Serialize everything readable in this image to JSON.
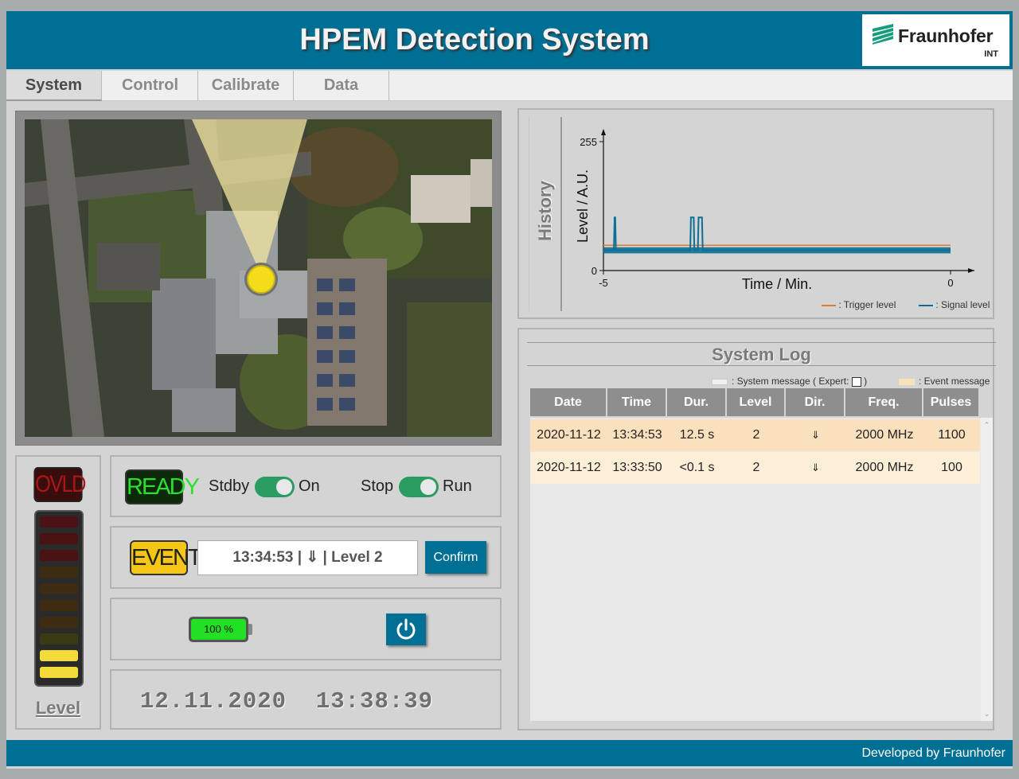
{
  "header": {
    "title": "HPEM Detection System",
    "logo_name": "Fraunhofer",
    "logo_sub": "INT"
  },
  "tabs": [
    {
      "label": "System",
      "active": true
    },
    {
      "label": "Control",
      "active": false
    },
    {
      "label": "Calibrate",
      "active": false
    },
    {
      "label": "Data",
      "active": false
    }
  ],
  "level_meter": {
    "ovld_label": "OVLD",
    "label": "Level",
    "segments_total": 10,
    "segments_lit": 2
  },
  "status": {
    "ready_label": "READY",
    "standby_label": "Stdby",
    "on_label": "On",
    "stop_label": "Stop",
    "run_label": "Run",
    "power_toggle_on": true,
    "run_toggle_on": true
  },
  "event": {
    "indicator_label": "EVENT",
    "message": "13:34:53 | ⇓ | Level 2",
    "confirm_label": "Confirm"
  },
  "battery": {
    "label": "100 %",
    "percent": 100
  },
  "clock": {
    "date": "12.11.2020",
    "time": "13:38:39"
  },
  "history": {
    "panel_label": "History",
    "chart_data": {
      "type": "line",
      "xlabel": "Time / Min.",
      "ylabel": "Level / A.U.",
      "xlim": [
        -5,
        0
      ],
      "ylim": [
        0,
        255
      ],
      "yticks": [
        0,
        255
      ],
      "xticks": [
        -5,
        0
      ],
      "series": [
        {
          "name": "Trigger level",
          "color": "#e07b2a",
          "x": [
            -5,
            0
          ],
          "y": [
            50,
            50
          ]
        },
        {
          "name": "Signal level",
          "color": "#0e6f96",
          "x": [
            -5,
            -4.85,
            -4.84,
            -4.83,
            -4.82,
            -3.75,
            -3.74,
            -3.7,
            -3.69,
            -3.64,
            -3.63,
            -3.58,
            -3.57,
            -3.56,
            -3.55,
            0
          ],
          "y": [
            40,
            40,
            105,
            105,
            40,
            40,
            105,
            105,
            40,
            40,
            105,
            105,
            40,
            40,
            40,
            40
          ]
        }
      ]
    },
    "legend": {
      "trigger": "Trigger level",
      "signal": "Signal level"
    }
  },
  "log": {
    "title": "System Log",
    "legend_system": "System message ( Expert:",
    "legend_system_close": ")",
    "legend_event": "Event message",
    "columns": [
      "Date",
      "Time",
      "Dur.",
      "Level",
      "Dir.",
      "Freq.",
      "Pulses"
    ],
    "rows": [
      [
        "2020-11-12",
        "13:34:53",
        "12.5 s",
        "2",
        "⇓",
        "2000 MHz",
        "1100"
      ],
      [
        "2020-11-12",
        "13:33:50",
        "<0.1 s",
        "2",
        "⇓",
        "2000 MHz",
        "100"
      ]
    ],
    "row_colors": [
      "#fbe0bd",
      "#fdeed8"
    ]
  },
  "footer": {
    "text": "Developed by Fraunhofer"
  },
  "colors": {
    "brand": "#006f94",
    "panel": "#d4d4d4",
    "toggle": "#2a9c62"
  }
}
